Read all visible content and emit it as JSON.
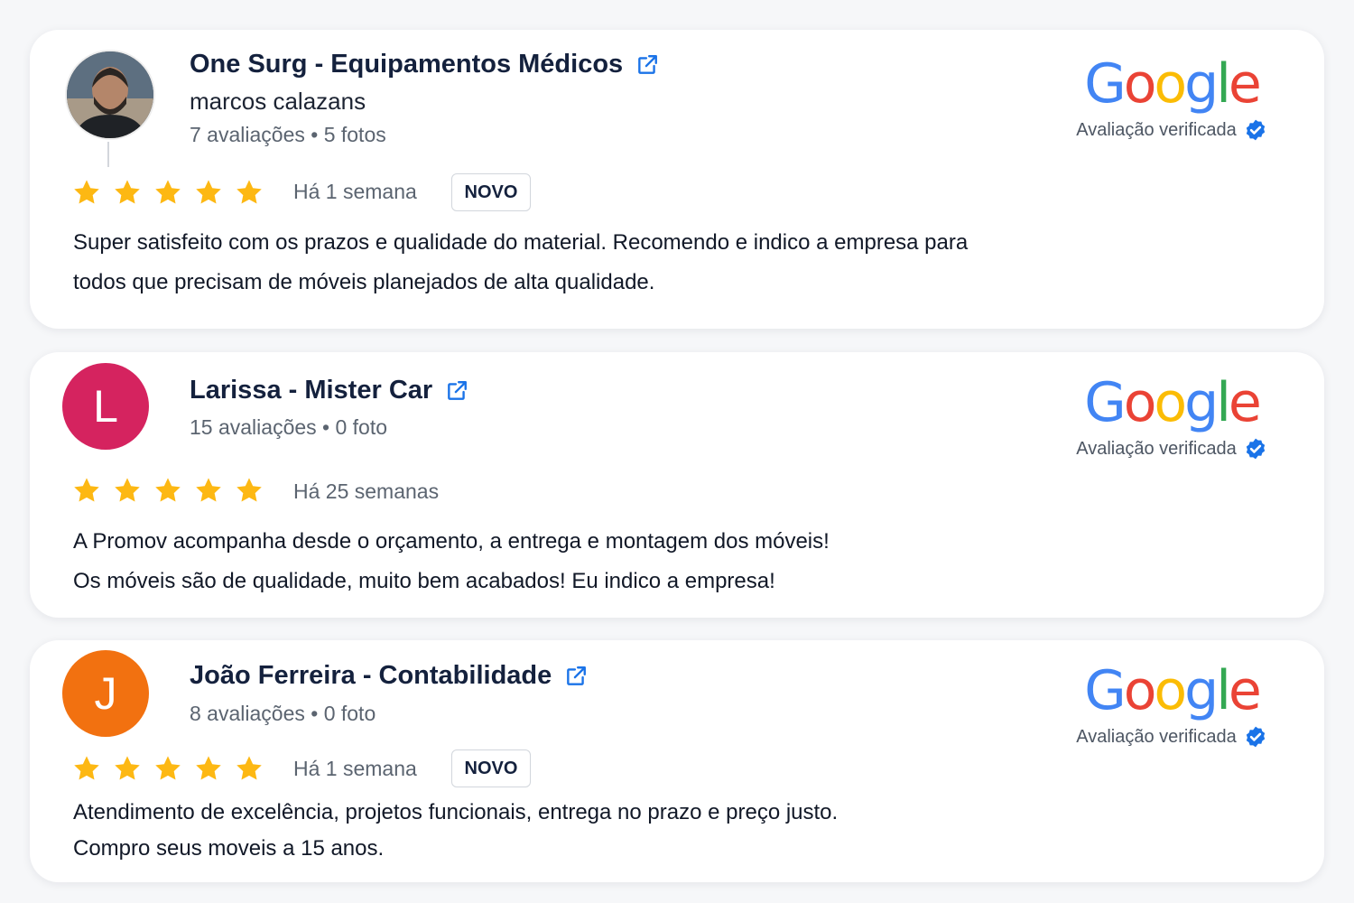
{
  "colors": {
    "star": "#FDB813",
    "link_icon": "#1a73e8",
    "verified_badge": "#1a73e8",
    "avatar_l": "#D5235F",
    "avatar_j": "#F27110"
  },
  "google": {
    "logo_letters": [
      "G",
      "o",
      "o",
      "g",
      "l",
      "e"
    ],
    "logo_colors": [
      "#4285F4",
      "#EA4335",
      "#FBBC05",
      "#4285F4",
      "#34A853",
      "#EA4335"
    ],
    "verified_label": "Avaliação verificada"
  },
  "reviews": [
    {
      "title": "One Surg - Equipamentos Médicos",
      "reviewer": "marcos calazans",
      "meta": "7 avaliações • 5 fotos",
      "avatar": "photo",
      "rating": 5,
      "time": "Há 1 semana",
      "badge": "NOVO",
      "text": [
        "Super satisfeito com os prazos e qualidade do material. Recomendo e indico a empresa para",
        "todos que precisam de móveis planejados de alta qualidade."
      ]
    },
    {
      "title": "Larissa - Mister Car",
      "meta": "15 avaliações • 0 foto",
      "avatar_letter": "L",
      "rating": 5,
      "time": "Há 25 semanas",
      "text": [
        "A Promov acompanha desde o orçamento, a entrega e montagem dos móveis!",
        "Os móveis são de qualidade, muito bem acabados! Eu indico a empresa!"
      ]
    },
    {
      "title": "João Ferreira - Contabilidade",
      "meta": "8 avaliações • 0 foto",
      "avatar_letter": "J",
      "rating": 5,
      "time": "Há 1 semana",
      "badge": "NOVO",
      "text": [
        "Atendimento de excelência, projetos funcionais, entrega no prazo e preço justo.",
        "Compro seus moveis a 15 anos."
      ]
    }
  ]
}
